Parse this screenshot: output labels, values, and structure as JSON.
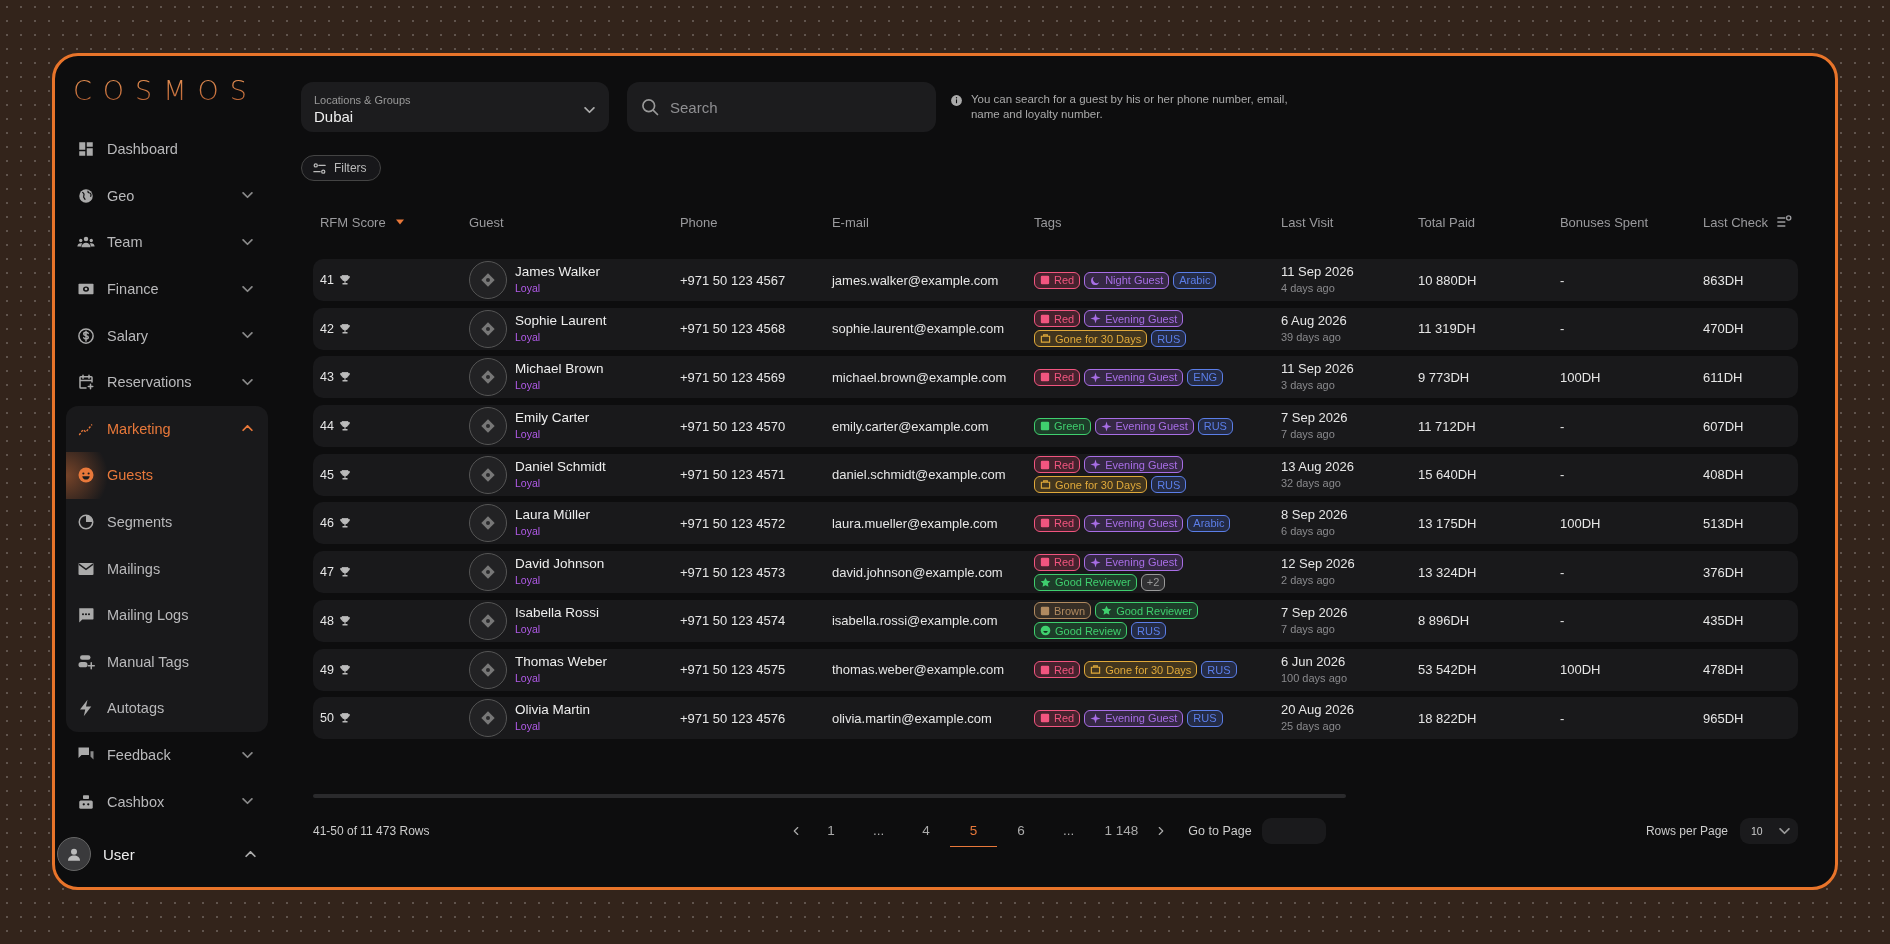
{
  "sidebar": {
    "logo": "COSMOS",
    "items": [
      {
        "label": "Dashboard",
        "selected": false
      },
      {
        "label": "Geo",
        "expanded": false,
        "selected": false
      },
      {
        "label": "Team",
        "expanded": false,
        "selected": false
      },
      {
        "label": "Finance",
        "expanded": false,
        "selected": false
      },
      {
        "label": "Salary",
        "expanded": false,
        "selected": false
      },
      {
        "label": "Reservations",
        "expanded": false,
        "selected": false
      },
      {
        "label": "Marketing",
        "expanded": true,
        "selected": false,
        "children": [
          {
            "label": "Guests",
            "selected": true
          },
          {
            "label": "Segments",
            "selected": false
          },
          {
            "label": "Mailings",
            "selected": false
          },
          {
            "label": "Mailing Logs",
            "selected": false
          },
          {
            "label": "Manual Tags",
            "selected": false
          },
          {
            "label": "Autotags",
            "selected": false
          }
        ]
      },
      {
        "label": "Feedback",
        "expanded": false,
        "selected": false
      },
      {
        "label": "Cashbox",
        "expanded": false,
        "selected": false
      }
    ],
    "user": {
      "name": "User"
    }
  },
  "toolbar": {
    "location": {
      "label": "Locations & Groups",
      "value": "Dubai"
    },
    "search": {
      "placeholder": "Search"
    },
    "hint": "You can search for a guest by his or her phone number, email, name and loyalty number.",
    "filters_button": "Filters"
  },
  "table": {
    "columns": [
      {
        "label": "RFM Score",
        "sorted": true
      },
      {
        "label": "Guest"
      },
      {
        "label": "Phone"
      },
      {
        "label": "E-mail"
      },
      {
        "label": "Tags"
      },
      {
        "label": "Last Visit"
      },
      {
        "label": "Total Paid"
      },
      {
        "label": "Bonuses Spent"
      },
      {
        "label": "Last Check"
      }
    ],
    "rows": [
      {
        "rfm": "41",
        "name": "James Walker",
        "status": "Loyal",
        "phone": "+971 50 123 4567",
        "email": "james.walker@example.com",
        "tags": [
          {
            "label": "Red",
            "kind": "square",
            "color": "#f2557f"
          },
          {
            "label": "Night Guest",
            "kind": "moon",
            "color": "#a86ee6"
          },
          {
            "label": "Arabic",
            "kind": "plain",
            "color": "#5b7ee8"
          }
        ],
        "last_visit": "11 Sep 2026",
        "ago": "4 days ago",
        "total_paid": "10 880DH",
        "bonuses_spent": "-",
        "last_check": "863DH"
      },
      {
        "rfm": "42",
        "name": "Sophie Laurent",
        "status": "Loyal",
        "phone": "+971 50 123 4568",
        "email": "sophie.laurent@example.com",
        "tags": [
          {
            "label": "Red",
            "kind": "square",
            "color": "#f2557f"
          },
          {
            "label": "Evening Guest",
            "kind": "sparkle",
            "color": "#a86ee6"
          },
          {
            "label": "Gone for 30 Days",
            "kind": "bag",
            "color": "#e0a93a"
          },
          {
            "label": "RUS",
            "kind": "plain",
            "color": "#5b7ee8"
          }
        ],
        "last_visit": "6 Aug 2026",
        "ago": "39 days ago",
        "total_paid": "11 319DH",
        "bonuses_spent": "-",
        "last_check": "470DH"
      },
      {
        "rfm": "43",
        "name": "Michael Brown",
        "status": "Loyal",
        "phone": "+971 50 123 4569",
        "email": "michael.brown@example.com",
        "tags": [
          {
            "label": "Red",
            "kind": "square",
            "color": "#f2557f"
          },
          {
            "label": "Evening Guest",
            "kind": "sparkle",
            "color": "#a86ee6"
          },
          {
            "label": "ENG",
            "kind": "plain",
            "color": "#5b7ee8"
          }
        ],
        "last_visit": "11 Sep 2026",
        "ago": "3 days ago",
        "total_paid": "9 773DH",
        "bonuses_spent": "100DH",
        "last_check": "611DH"
      },
      {
        "rfm": "44",
        "name": "Emily Carter",
        "status": "Loyal",
        "phone": "+971 50 123 4570",
        "email": "emily.carter@example.com",
        "tags": [
          {
            "label": "Green",
            "kind": "square",
            "color": "#3fcf6e"
          },
          {
            "label": "Evening Guest",
            "kind": "sparkle",
            "color": "#a86ee6"
          },
          {
            "label": "RUS",
            "kind": "plain",
            "color": "#5b7ee8"
          }
        ],
        "last_visit": "7 Sep 2026",
        "ago": "7 days ago",
        "total_paid": "11 712DH",
        "bonuses_spent": "-",
        "last_check": "607DH"
      },
      {
        "rfm": "45",
        "name": "Daniel Schmidt",
        "status": "Loyal",
        "phone": "+971 50 123 4571",
        "email": "daniel.schmidt@example.com",
        "tags": [
          {
            "label": "Red",
            "kind": "square",
            "color": "#f2557f"
          },
          {
            "label": "Evening Guest",
            "kind": "sparkle",
            "color": "#a86ee6"
          },
          {
            "label": "Gone for 30 Days",
            "kind": "bag",
            "color": "#e0a93a"
          },
          {
            "label": "RUS",
            "kind": "plain",
            "color": "#5b7ee8"
          }
        ],
        "last_visit": "13 Aug 2026",
        "ago": "32 days ago",
        "total_paid": "15 640DH",
        "bonuses_spent": "-",
        "last_check": "408DH"
      },
      {
        "rfm": "46",
        "name": "Laura Müller",
        "status": "Loyal",
        "phone": "+971 50 123 4572",
        "email": "laura.mueller@example.com",
        "tags": [
          {
            "label": "Red",
            "kind": "square",
            "color": "#f2557f"
          },
          {
            "label": "Evening Guest",
            "kind": "sparkle",
            "color": "#a86ee6"
          },
          {
            "label": "Arabic",
            "kind": "plain",
            "color": "#5b7ee8"
          }
        ],
        "last_visit": "8 Sep 2026",
        "ago": "6 days ago",
        "total_paid": "13 175DH",
        "bonuses_spent": "100DH",
        "last_check": "513DH"
      },
      {
        "rfm": "47",
        "name": "David Johnson",
        "status": "Loyal",
        "phone": "+971 50 123 4573",
        "email": "david.johnson@example.com",
        "tags": [
          {
            "label": "Red",
            "kind": "square",
            "color": "#f2557f"
          },
          {
            "label": "Evening Guest",
            "kind": "sparkle",
            "color": "#a86ee6"
          },
          {
            "label": "Good Reviewer",
            "kind": "star",
            "color": "#3fcf6e"
          },
          {
            "label": "+2",
            "kind": "plain",
            "color": "#9a9a9a"
          }
        ],
        "last_visit": "12 Sep 2026",
        "ago": "2 days ago",
        "total_paid": "13 324DH",
        "bonuses_spent": "-",
        "last_check": "376DH"
      },
      {
        "rfm": "48",
        "name": "Isabella Rossi",
        "status": "Loyal",
        "phone": "+971 50 123 4574",
        "email": "isabella.rossi@example.com",
        "tags": [
          {
            "label": "Brown",
            "kind": "square",
            "color": "#b08a60"
          },
          {
            "label": "Good Reviewer",
            "kind": "star",
            "color": "#3fcf6e"
          },
          {
            "label": "Good Review",
            "kind": "smile",
            "color": "#3fcf6e"
          },
          {
            "label": "RUS",
            "kind": "plain",
            "color": "#5b7ee8"
          }
        ],
        "last_visit": "7 Sep 2026",
        "ago": "7 days ago",
        "total_paid": "8 896DH",
        "bonuses_spent": "-",
        "last_check": "435DH"
      },
      {
        "rfm": "49",
        "name": "Thomas Weber",
        "status": "Loyal",
        "phone": "+971 50 123 4575",
        "email": "thomas.weber@example.com",
        "tags": [
          {
            "label": "Red",
            "kind": "square",
            "color": "#f2557f"
          },
          {
            "label": "Gone for 30 Days",
            "kind": "bag",
            "color": "#e0a93a"
          },
          {
            "label": "RUS",
            "kind": "plain",
            "color": "#5b7ee8"
          }
        ],
        "last_visit": "6 Jun 2026",
        "ago": "100 days ago",
        "total_paid": "53 542DH",
        "bonuses_spent": "100DH",
        "last_check": "478DH"
      },
      {
        "rfm": "50",
        "name": "Olivia Martin",
        "status": "Loyal",
        "phone": "+971 50 123 4576",
        "email": "olivia.martin@example.com",
        "tags": [
          {
            "label": "Red",
            "kind": "square",
            "color": "#f2557f"
          },
          {
            "label": "Evening Guest",
            "kind": "sparkle",
            "color": "#a86ee6"
          },
          {
            "label": "RUS",
            "kind": "plain",
            "color": "#5b7ee8"
          }
        ],
        "last_visit": "20 Aug 2026",
        "ago": "25 days ago",
        "total_paid": "18 822DH",
        "bonuses_spent": "-",
        "last_check": "965DH"
      }
    ]
  },
  "footer": {
    "summary": "41-50 of 11 473 Rows",
    "pages": [
      {
        "label": "1",
        "selected": false
      },
      {
        "label": "...",
        "selected": false
      },
      {
        "label": "4",
        "selected": false
      },
      {
        "label": "5",
        "selected": true
      },
      {
        "label": "6",
        "selected": false
      },
      {
        "label": "...",
        "selected": false
      },
      {
        "label": "1 148",
        "selected": false
      }
    ],
    "go_to_page": {
      "label": "Go to Page"
    },
    "rows_per_page": {
      "label": "Rows per Page",
      "value": "10"
    }
  }
}
